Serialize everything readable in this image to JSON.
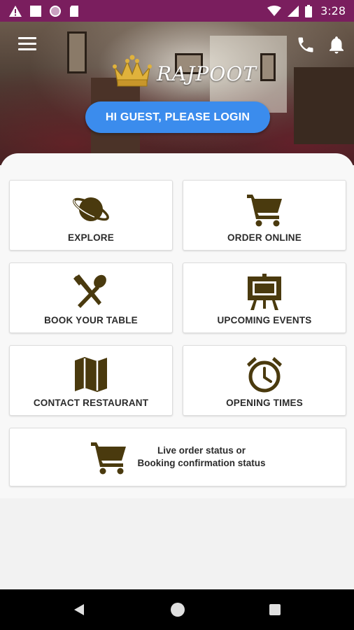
{
  "status_bar": {
    "time": "3:28",
    "left_icons": [
      "warning-icon",
      "square-icon",
      "circle-icon",
      "sd-card-icon"
    ],
    "right_icons": [
      "wifi-icon",
      "signal-icon",
      "battery-icon"
    ]
  },
  "header": {
    "brand": "RAJPOOT",
    "login_label": "HI GUEST, PLEASE LOGIN",
    "icons": [
      "menu-icon",
      "phone-icon",
      "bell-icon"
    ]
  },
  "tiles": [
    {
      "label": "EXPLORE",
      "icon": "planet-icon"
    },
    {
      "label": "ORDER ONLINE",
      "icon": "shopping-cart-icon"
    },
    {
      "label": "BOOK YOUR TABLE",
      "icon": "knife-spoon-icon"
    },
    {
      "label": "UPCOMING EVENTS",
      "icon": "easel-icon"
    },
    {
      "label": "CONTACT RESTAURANT",
      "icon": "map-icon"
    },
    {
      "label": "OPENING TIMES",
      "icon": "alarm-clock-icon"
    }
  ],
  "status_tile": {
    "line1": "Live order status or",
    "line2": "Booking confirmation status",
    "icon": "shopping-cart-icon"
  },
  "colors": {
    "status_bar": "#7a1e5e",
    "login_button": "#3b8ced",
    "icon_brown": "#4a3a0e"
  },
  "nav_bar": [
    "back-icon",
    "home-icon",
    "recents-icon"
  ]
}
